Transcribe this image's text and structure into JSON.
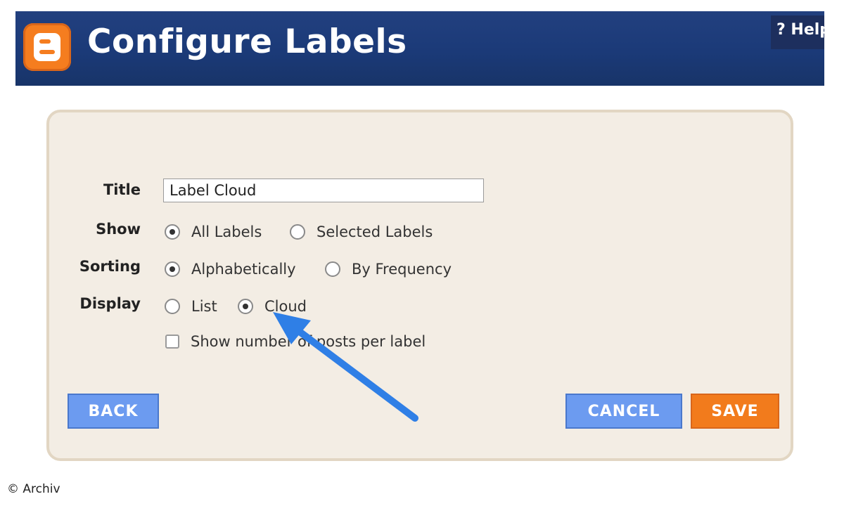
{
  "header": {
    "title": "Configure Labels",
    "help_label": "? Help",
    "logo_icon": "blogger-logo-icon",
    "bg_color": "#1b3a78",
    "logo_color": "#f57d1f"
  },
  "form": {
    "title_label": "Title",
    "title_value": "Label Cloud",
    "show": {
      "label": "Show",
      "options": [
        "All Labels",
        "Selected Labels"
      ],
      "selected": "All Labels"
    },
    "sorting": {
      "label": "Sorting",
      "options": [
        "Alphabetically",
        "By Frequency"
      ],
      "selected": "Alphabetically"
    },
    "display": {
      "label": "Display",
      "options": [
        "List",
        "Cloud"
      ],
      "selected": "Cloud"
    },
    "show_count_label": "Show number of posts per label",
    "show_count_checked": false
  },
  "buttons": {
    "back": "BACK",
    "cancel": "CANCEL",
    "save": "SAVE"
  },
  "annotation": {
    "icon": "arrow-icon",
    "color": "#3a86e8"
  },
  "watermark": "© Archiv"
}
